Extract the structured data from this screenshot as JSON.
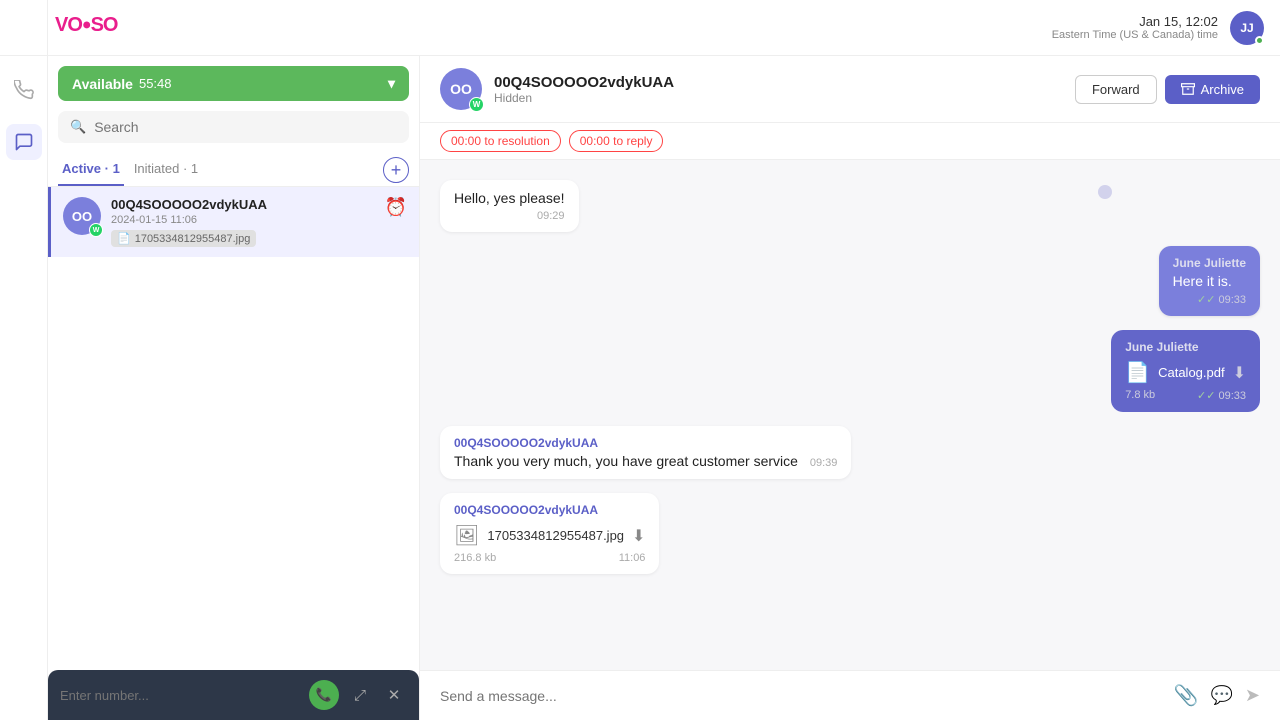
{
  "app": {
    "logo": "VOISO"
  },
  "topbar": {
    "datetime": "Jan 15, 12:02",
    "timezone": "Eastern Time (US & Canada) time",
    "avatar_initials": "JJ",
    "avatar_dot_color": "#4caf50"
  },
  "left_panel": {
    "available_bar": {
      "label": "Available",
      "timer": "55:48"
    },
    "search": {
      "placeholder": "Search"
    },
    "tabs": [
      {
        "label": "Active",
        "count": 1,
        "active": true
      },
      {
        "label": "Initiated",
        "count": 1,
        "active": false
      }
    ],
    "conversations": [
      {
        "id": "00Q4SOOOOO2vdykUAA",
        "avatar_initials": "OO",
        "date": "2024-01-15 11:06",
        "file": "1705334812955487.jpg",
        "status": "overdue"
      }
    ]
  },
  "dial_pad": {
    "placeholder": "Enter number...",
    "phone_icon": "📞",
    "expand_icon": "⤢",
    "close_icon": "✕"
  },
  "chat": {
    "contact_id": "00Q4SOOOOO2vdykUAA",
    "contact_status": "Hidden",
    "avatar_initials": "OO",
    "timers": {
      "resolution": "00:00 to resolution",
      "reply": "00:00 to reply"
    },
    "forward_label": "Forward",
    "archive_label": "Archive",
    "messages": [
      {
        "type": "incoming",
        "sender": "00Q4SOOOOO2vdykUAA",
        "text": "Hello, yes please!",
        "time": "09:29"
      },
      {
        "type": "outgoing",
        "sender": "June Juliette",
        "text": "Here it is.",
        "time": "09:33",
        "checkmarks": "✓✓"
      },
      {
        "type": "outgoing-file",
        "sender": "June Juliette",
        "file_name": "Catalog.pdf",
        "file_size": "7.8 kb",
        "time": "09:33",
        "checkmarks": "✓✓"
      },
      {
        "type": "incoming",
        "sender": "00Q4SOOOOO2vdykUAA",
        "text": "Thank you very much, you have great customer service",
        "time": "09:39"
      },
      {
        "type": "incoming-file",
        "sender": "00Q4SOOOOO2vdykUAA",
        "file_name": "1705334812955487.jpg",
        "file_size": "216.8 kb",
        "time": "11:06"
      }
    ],
    "input_placeholder": "Send a message..."
  },
  "sidebar_icons": [
    {
      "name": "phone-icon",
      "symbol": "📞",
      "active": false
    },
    {
      "name": "chat-icon",
      "symbol": "💬",
      "active": true
    }
  ]
}
